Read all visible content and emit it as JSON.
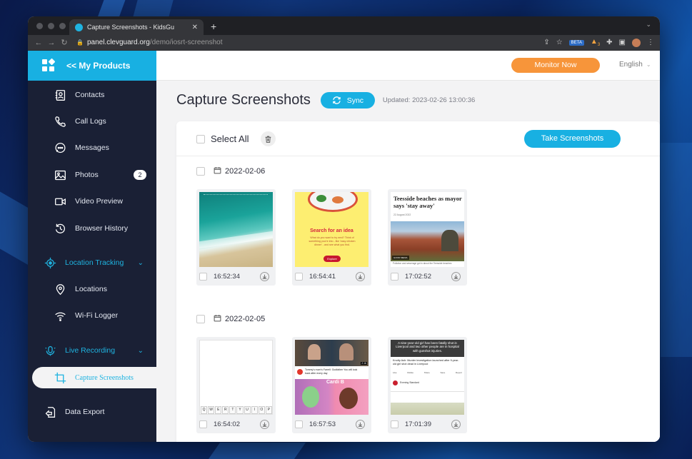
{
  "browser": {
    "tab_title": "Capture Screenshots - KidsGu",
    "url_host": "panel.clevguard.org",
    "url_path": "/demo/iosrt-screenshot",
    "beta_label": "BETA",
    "ext_badge": "3"
  },
  "brand": {
    "label": "<< My Products"
  },
  "sidebar": {
    "items": [
      {
        "label": "Contacts"
      },
      {
        "label": "Call Logs"
      },
      {
        "label": "Messages"
      },
      {
        "label": "Photos",
        "badge": "2"
      },
      {
        "label": "Video Preview"
      },
      {
        "label": "Browser History"
      }
    ],
    "location_group": "Location Tracking",
    "location_items": [
      {
        "label": "Locations"
      },
      {
        "label": "Wi-Fi Logger"
      }
    ],
    "recording_group": "Live Recording",
    "active_item": "Capture Screenshots",
    "export_item": "Data Export"
  },
  "topbar": {
    "monitor_label": "Monitor Now",
    "language": "English"
  },
  "header": {
    "title": "Capture Screenshots",
    "sync_label": "Sync",
    "updated": "Updated: 2023-02-26 13:00:36"
  },
  "toolbar": {
    "select_all": "Select All",
    "take_label": "Take Screenshots"
  },
  "groups": [
    {
      "date": "2022-02-06",
      "shots": [
        {
          "time": "16:52:34"
        },
        {
          "time": "16:54:41",
          "caption": "Search for an idea",
          "body": "What do you want to try next? Think of something you're into - like 'easy chicken dinner' - and see what you find.",
          "button": "Explore"
        },
        {
          "time": "17:02:52",
          "headline": "Teesside beaches as mayor says 'stay away'",
          "date_line": "22 August 2022",
          "photo_tag": "GOOD MEDIA",
          "snippet": "Pollution and sewerage got in about the Teesside beaches"
        }
      ]
    },
    {
      "date": "2022-02-05",
      "shots": [
        {
          "time": "16:54:02",
          "keys": [
            "Q",
            "W",
            "E",
            "R",
            "T",
            "Y",
            "U",
            "I",
            "O",
            "P"
          ]
        },
        {
          "time": "16:57:53",
          "video_title": "Tommy's mom's Farrell: Godfather You will look back after every day",
          "channel": "Cardi B",
          "duration": "2:16"
        },
        {
          "time": "17:01:39",
          "overlay": "A nine-year-old girl has been fatally shot in Liverpool and two other people are in hospital with gunshot injuries.",
          "headline": "Knotty Ash: Murder investigation launched after 9-year-old girl shot dead in Liverpool",
          "source": "Evening Standard",
          "tabs": [
            "Like",
            "Dislike",
            "Share",
            "Save",
            "Report"
          ]
        }
      ]
    }
  ],
  "colors": {
    "accent": "#18b0e2",
    "sidebar_bg": "#1a2035",
    "monitor": "#f7953a"
  }
}
